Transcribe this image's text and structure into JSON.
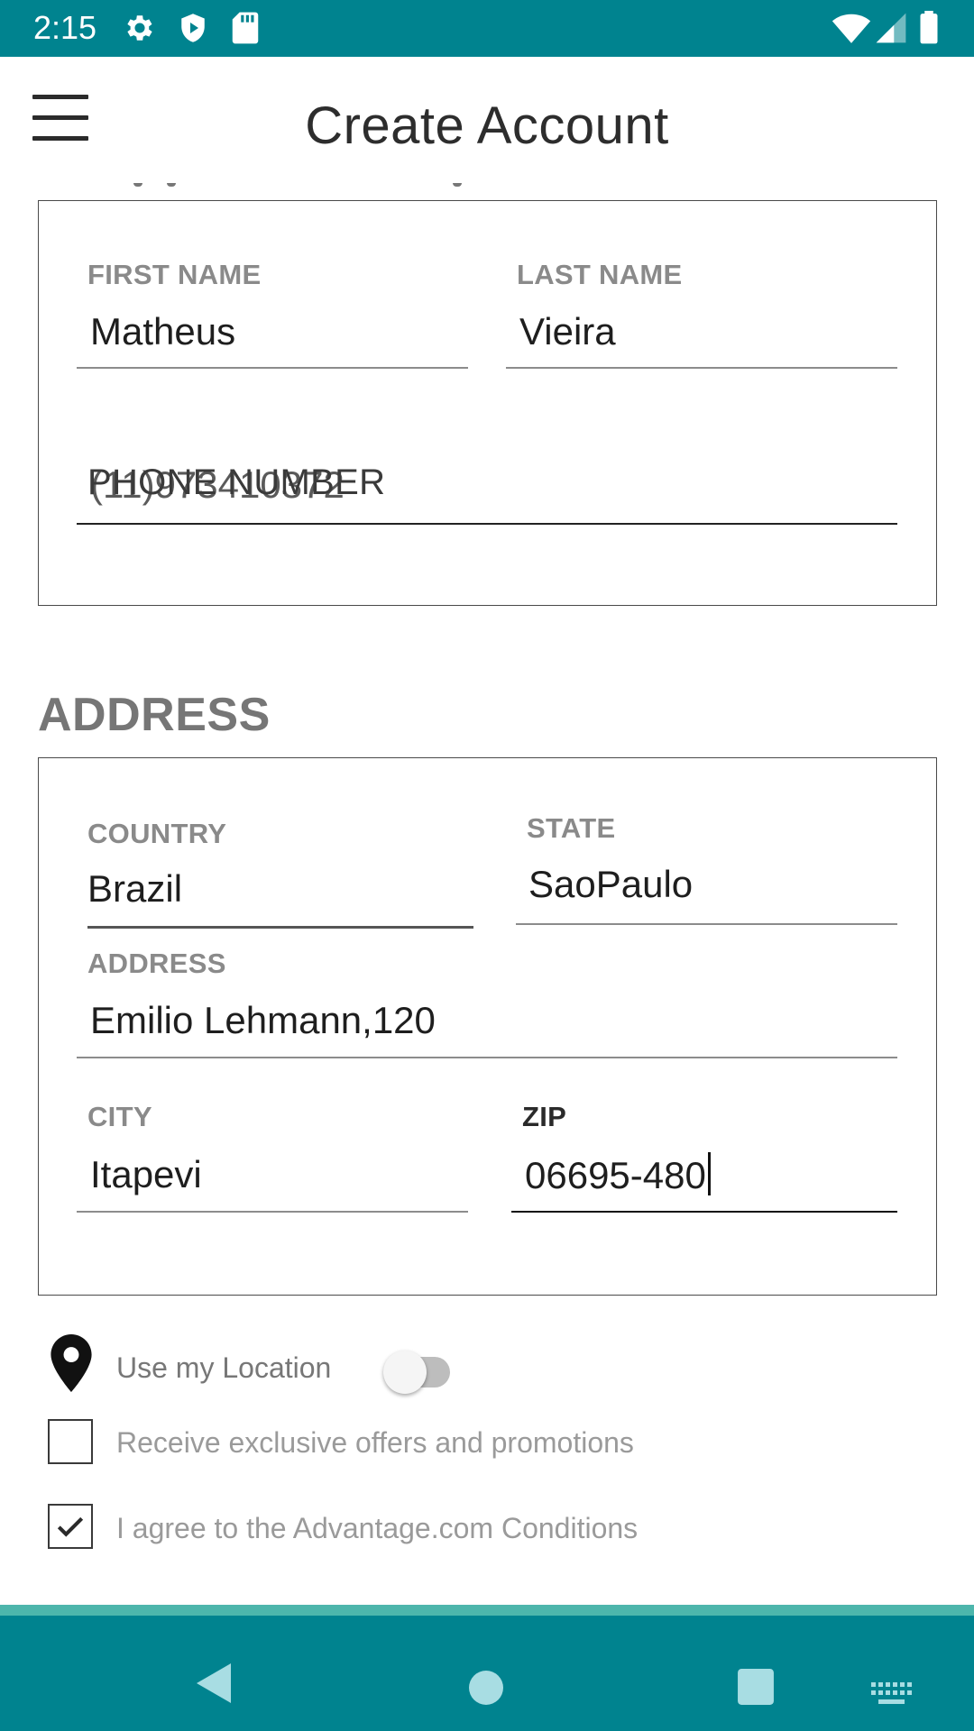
{
  "status_bar": {
    "time": "2:15",
    "icons": [
      "gear-icon",
      "shield-play-icon",
      "sd-card-icon",
      "wifi-icon",
      "signal-icon",
      "battery-icon"
    ],
    "background": "#00838f"
  },
  "app_bar": {
    "title": "Create Account",
    "menu_icon": "hamburger-menu-icon"
  },
  "personal": {
    "first_name": {
      "label": "FIRST NAME",
      "value": "Matheus"
    },
    "last_name": {
      "label": "LAST NAME",
      "value": "Vieira"
    },
    "phone": {
      "label": "PHONE NUMBER",
      "value": "(11)973410372"
    }
  },
  "address_section": {
    "heading": "ADDRESS",
    "country": {
      "label": "COUNTRY",
      "value": "Brazil"
    },
    "state": {
      "label": "STATE",
      "value": "SaoPaulo"
    },
    "address": {
      "label": "ADDRESS",
      "value": "Emilio Lehmann,120"
    },
    "city": {
      "label": "CITY",
      "value": "Itapevi"
    },
    "zip": {
      "label": "ZIP",
      "value": "06695-480"
    }
  },
  "options": {
    "use_location": {
      "label": "Use my Location",
      "enabled": false,
      "icon": "location-pin-icon"
    },
    "offers": {
      "label": "Receive exclusive offers and promotions",
      "checked": false
    },
    "conditions": {
      "label": "I agree to the Advantage.com Conditions",
      "checked": true
    }
  },
  "nav_bar": {
    "buttons": [
      "back-icon",
      "home-icon",
      "recents-icon",
      "keyboard-icon"
    ],
    "background": "#00838f",
    "accent": "#4db6ac"
  }
}
